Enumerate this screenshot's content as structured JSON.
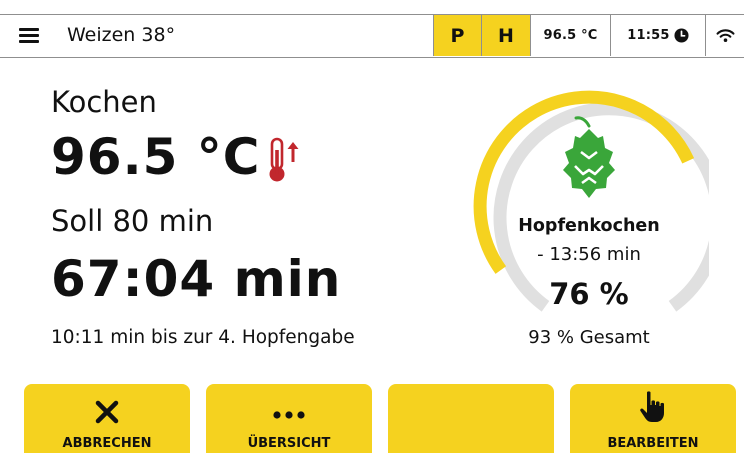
{
  "topbar": {
    "recipe_name": "Weizen 38°",
    "pill_p": "P",
    "pill_h": "H",
    "temperature": "96.5 °C",
    "time": "11:55"
  },
  "main": {
    "stage": "Kochen",
    "current_temp": "96.5 °C",
    "target": "Soll 80 min",
    "remaining": "67:04 min",
    "next_hop": "10:11 min bis zur 4. Hopfengabe"
  },
  "gauge": {
    "phase": "Hopfenkochen",
    "phase_time": "- 13:56 min",
    "percent_label": "76 %",
    "total_label": "93 % Gesamt",
    "progress": 0.76
  },
  "buttons": {
    "cancel": "ABBRECHEN",
    "overview": "ÜBERSICHT",
    "edit": "BEARBEITEN"
  },
  "colors": {
    "accent": "#f5d21f",
    "hop_green": "#3aa63a",
    "thermo_red": "#c1272d",
    "track_grey": "#e0e0e0"
  }
}
